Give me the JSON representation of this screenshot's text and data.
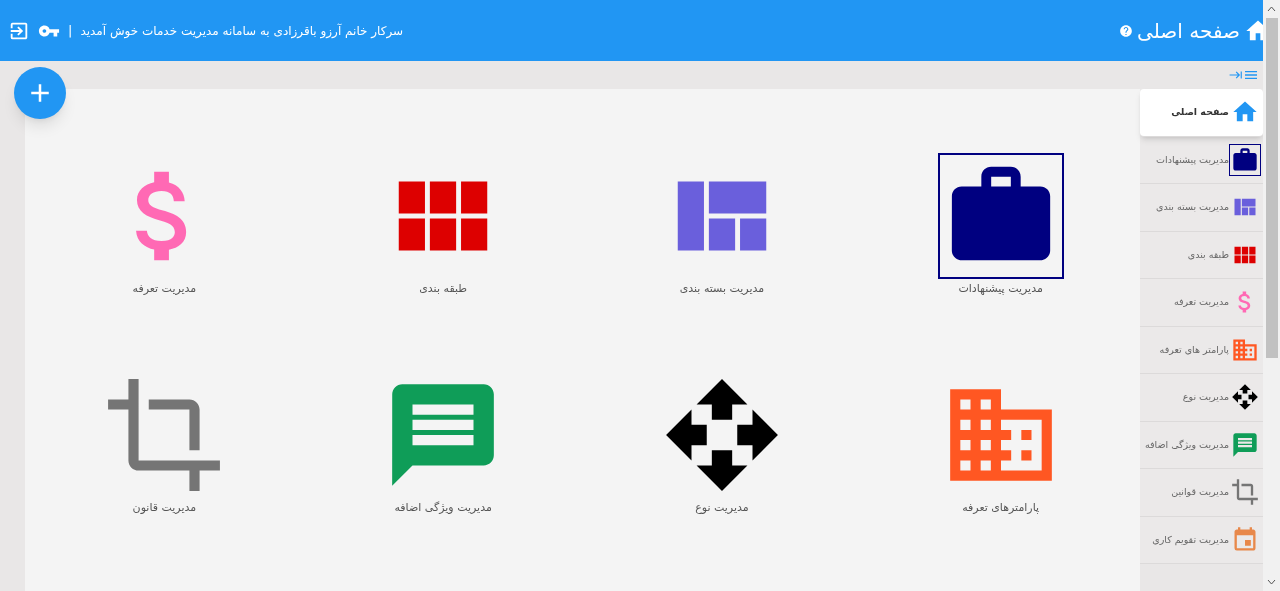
{
  "header": {
    "title": "صفحه اصلی",
    "welcome": "سرکار خانم آرزو باقرزادی به سامانه مدیریت خدمات خوش آمدید",
    "separator": "|"
  },
  "tiles": [
    {
      "kind": "briefcase",
      "label": "مدیریت پیشنهادات",
      "selected": true
    },
    {
      "kind": "quilt",
      "label": "مدیریت بسته بندی",
      "selected": false
    },
    {
      "kind": "grid",
      "label": "طبقه بندی",
      "selected": false
    },
    {
      "kind": "dollar",
      "label": "مدیریت تعرفه",
      "selected": false
    },
    {
      "kind": "building",
      "label": "پارامترهای تعرفه",
      "selected": false
    },
    {
      "kind": "move",
      "label": "مدیریت نوع",
      "selected": false
    },
    {
      "kind": "message",
      "label": "مدیریت ویژگی اضافه",
      "selected": false
    },
    {
      "kind": "crop",
      "label": "مدیریت قانون",
      "selected": false
    }
  ],
  "sidebar": {
    "items": [
      {
        "kind": "home",
        "label": "صفحه اصلی",
        "selected": true,
        "outlined": false
      },
      {
        "kind": "briefcase",
        "label": "مدیریت پیشنهادات",
        "selected": false,
        "outlined": true
      },
      {
        "kind": "quilt",
        "label": "مدیریت بسته بندی",
        "selected": false,
        "outlined": false
      },
      {
        "kind": "grid",
        "label": "طبقه بندی",
        "selected": false,
        "outlined": false
      },
      {
        "kind": "dollar",
        "label": "مدیریت تعرفه",
        "selected": false,
        "outlined": false
      },
      {
        "kind": "building",
        "label": "پارامتر های تعرفه",
        "selected": false,
        "outlined": false
      },
      {
        "kind": "move",
        "label": "مدیریت نوع",
        "selected": false,
        "outlined": false
      },
      {
        "kind": "message",
        "label": "مدیریت ویژگی اضافه",
        "selected": false,
        "outlined": false
      },
      {
        "kind": "crop",
        "label": "مدیریت قوانین",
        "selected": false,
        "outlined": false
      },
      {
        "kind": "calendar",
        "label": "مدیریت تقویم کاری",
        "selected": false,
        "outlined": false
      }
    ]
  }
}
